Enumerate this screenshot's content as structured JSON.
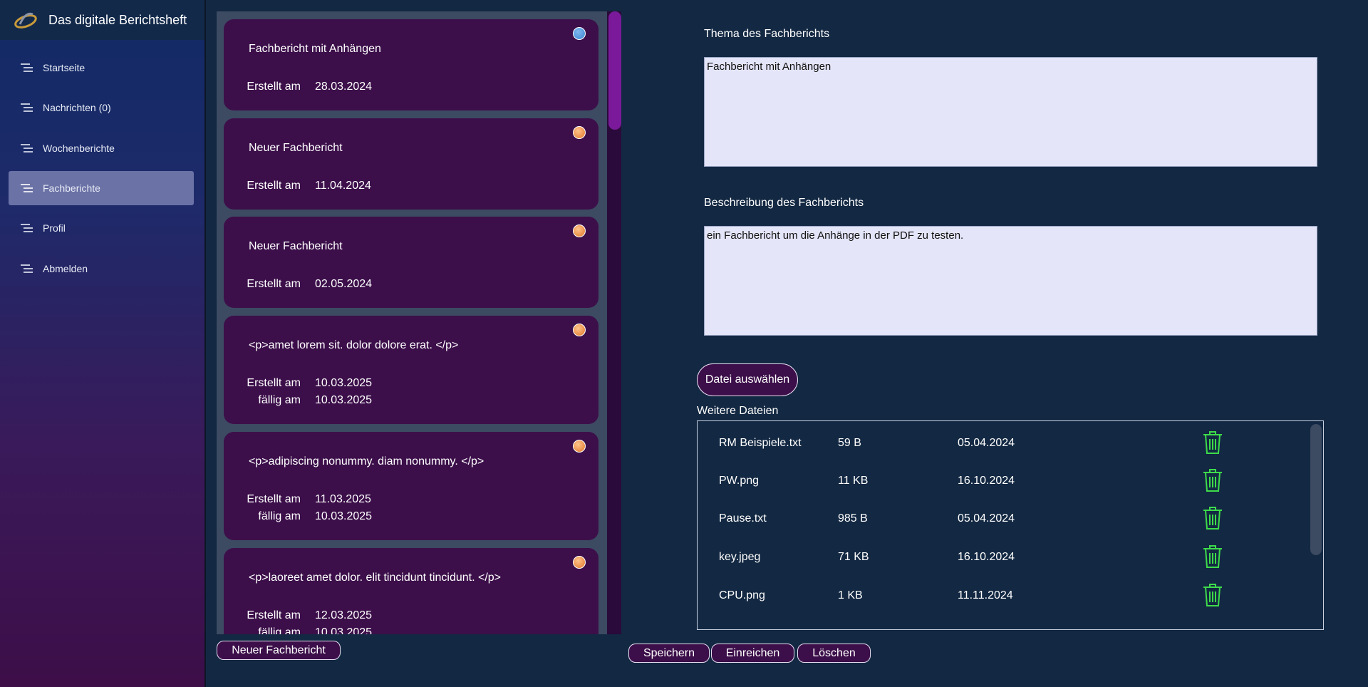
{
  "app": {
    "title": "Das digitale Berichtsheft"
  },
  "sidebar": {
    "items": [
      {
        "label": "Startseite",
        "icon": "menu-lines-icon"
      },
      {
        "label": "Nachrichten (0)",
        "icon": "menu-lines-icon"
      },
      {
        "label": "Wochenberichte",
        "icon": "menu-lines-icon"
      },
      {
        "label": "Fachberichte",
        "icon": "menu-lines-icon",
        "active": true
      },
      {
        "label": "Profil",
        "icon": "menu-lines-icon"
      },
      {
        "label": "Abmelden",
        "icon": "menu-lines-icon"
      }
    ]
  },
  "reports": {
    "created_label": "Erstellt am",
    "due_label": "fällig am",
    "items": [
      {
        "title": "Fachbericht mit Anhängen",
        "created": "28.03.2024",
        "status": "blue"
      },
      {
        "title": "Neuer Fachbericht",
        "created": "11.04.2024",
        "status": "orange"
      },
      {
        "title": "Neuer Fachbericht",
        "created": "02.05.2024",
        "status": "orange"
      },
      {
        "title": "<p>amet lorem sit. dolor dolore erat. </p>",
        "created": "10.03.2025",
        "due": "10.03.2025",
        "status": "orange"
      },
      {
        "title": "<p>adipiscing nonummy. diam nonummy. </p>",
        "created": "11.03.2025",
        "due": "10.03.2025",
        "status": "orange"
      },
      {
        "title": "<p>laoreet amet dolor. elit tincidunt tincidunt. </p>",
        "created": "12.03.2025",
        "due": "10.03.2025",
        "status": "orange"
      }
    ],
    "new_button": "Neuer Fachbericht"
  },
  "form": {
    "topic_label": "Thema des Fachberichts",
    "topic_value": "Fachbericht mit Anhängen",
    "description_label": "Beschreibung des Fachberichts",
    "description_value": "ein Fachbericht um die Anhänge in der PDF zu testen.",
    "choose_file_button": "Datei auswählen",
    "files_label": "Weitere Dateien",
    "files": [
      {
        "name": "RM Beispiele.txt",
        "size": "59 B",
        "date": "05.04.2024"
      },
      {
        "name": "PW.png",
        "size": "11 KB",
        "date": "16.10.2024"
      },
      {
        "name": "Pause.txt",
        "size": "985 B",
        "date": "05.04.2024"
      },
      {
        "name": "key.jpeg",
        "size": "71 KB",
        "date": "16.10.2024"
      },
      {
        "name": "CPU.png",
        "size": "1 KB",
        "date": "11.11.2024"
      }
    ]
  },
  "actions": {
    "save": "Speichern",
    "submit": "Einreichen",
    "delete": "Löschen"
  },
  "colors": {
    "accent": "#3c0f4a",
    "status_blue": "#3a86d4",
    "status_orange": "#e0762a",
    "trash_green": "#3ddc4a"
  }
}
